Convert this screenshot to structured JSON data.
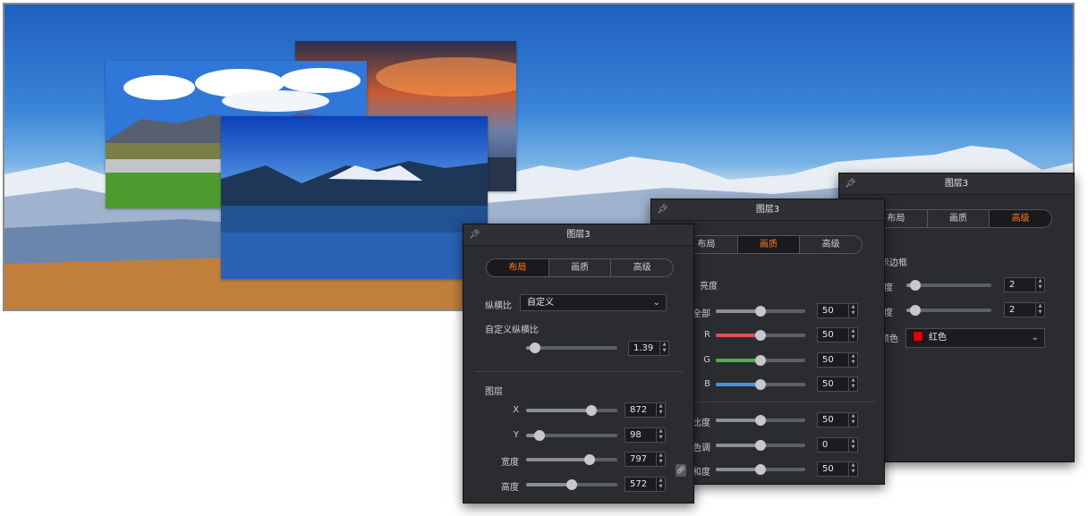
{
  "panels": {
    "layout": {
      "title": "图层3",
      "tabs": [
        "布局",
        "画质",
        "高级"
      ],
      "aspect_label": "纵横比",
      "aspect_value": "自定义",
      "custom_aspect_label": "自定义纵横比",
      "custom_aspect_value": "1.39",
      "custom_aspect_level": 0.1,
      "layer_label": "图层",
      "x_label": "X",
      "x_value": "872",
      "x_level": 0.72,
      "y_label": "Y",
      "y_value": "98",
      "y_level": 0.15,
      "w_label": "宽度",
      "w_value": "797",
      "w_level": 0.7,
      "h_label": "高度",
      "h_value": "572",
      "h_level": 0.5
    },
    "quality": {
      "title": "图层3",
      "tabs": [
        "布局",
        "画质",
        "高级"
      ],
      "brightness_label": "亮度",
      "all_label": "全部",
      "all_value": "50",
      "all_level": 0.5,
      "r_label": "R",
      "r_value": "50",
      "r_level": 0.5,
      "g_label": "G",
      "g_value": "50",
      "g_level": 0.5,
      "b_label": "B",
      "b_value": "50",
      "b_level": 0.5,
      "contrast_label": "比度",
      "contrast_value": "50",
      "contrast_level": 0.5,
      "hue_label": "色调",
      "hue_value": "0",
      "hue_level": 0.5,
      "saturation_label": "和度",
      "saturation_value": "50",
      "saturation_level": 0.5
    },
    "advanced": {
      "title": "图层3",
      "tabs": [
        "布局",
        "画质",
        "高级"
      ],
      "border_label": "示边框",
      "width_label": "度",
      "width_value": "2",
      "width_level": 0.1,
      "height_label": "度",
      "height_value": "2",
      "height_level": 0.1,
      "color_label": "颜色",
      "color_value": "红色",
      "color_hex": "#e60000"
    }
  },
  "colors": {
    "panel_bg": "#2b2c30",
    "active_tab_text": "#ff7a1a",
    "r_track": "#d9534f",
    "g_track": "#4caf50",
    "b_track": "#4a90d9"
  }
}
